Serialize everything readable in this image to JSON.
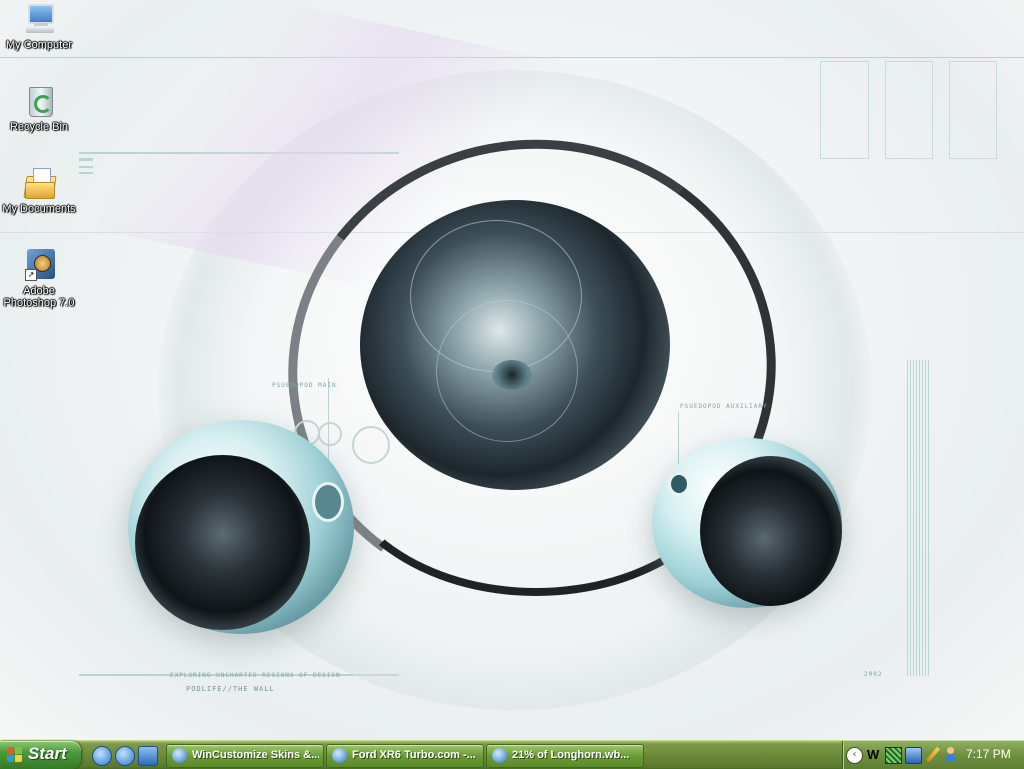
{
  "desktop": {
    "icons": [
      {
        "label": "My Computer",
        "icon": "my-computer-icon"
      },
      {
        "label": "Recycle Bin",
        "icon": "recycle-bin-icon"
      },
      {
        "label": "My Documents",
        "icon": "my-documents-icon"
      },
      {
        "label": "Adobe Photoshop 7.0",
        "icon": "photoshop-icon"
      }
    ]
  },
  "wallpaper": {
    "tagline": "EXPLORING UNCHARTED REGIONS OF DESIGN",
    "title": "PODLIFE//THE WALL",
    "year": "2002",
    "label_left": "PSUEDOPOD MAIN",
    "label_right": "PSUEDOPOD AUXILIARY"
  },
  "taskbar": {
    "start_label": "Start",
    "quick_launch": [
      "internet-explorer-icon",
      "internet-explorer-icon",
      "show-desktop-icon"
    ],
    "tasks": [
      {
        "label": "WinCustomize Skins &...",
        "icon": "internet-explorer-icon"
      },
      {
        "label": "Ford XR6 Turbo.com -...",
        "icon": "internet-explorer-icon"
      },
      {
        "label": "21% of Longhorn.wb...",
        "icon": "internet-explorer-icon"
      }
    ],
    "tray": {
      "expand_icon": "chevron-left-icon",
      "icons": [
        "w-app-icon",
        "network-grid-icon",
        "network-icon",
        "pencil-icon",
        "user-icon"
      ],
      "clock": "7:17 PM"
    }
  },
  "colors": {
    "taskbar": "#6d8a3a",
    "start": "#3f8a2e",
    "wallpaper_accent": "#7fa5a5"
  }
}
